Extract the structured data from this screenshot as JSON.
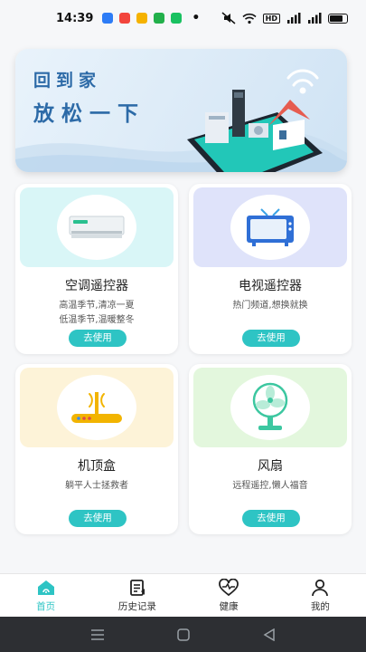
{
  "status_bar": {
    "time": "14:39",
    "indicators": "HD",
    "app_icon_colors": [
      "#2d7cf6",
      "#f2453d",
      "#f5b200",
      "#22b04b",
      "#19c161"
    ]
  },
  "banner": {
    "line1": "回到家",
    "line2": "放松一下"
  },
  "cards": [
    {
      "title": "空调遥控器",
      "desc1": "高温季节,清凉一夏",
      "desc2": "低温季节,温暖整冬",
      "button": "去使用",
      "icon": "air-conditioner-icon",
      "bg": "#d9f6f7"
    },
    {
      "title": "电视遥控器",
      "desc1": "热门频道,想换就换",
      "button": "去使用",
      "icon": "television-icon",
      "bg": "#dfe3fa"
    },
    {
      "title": "机顶盒",
      "desc1": "躺平人士拯救者",
      "button": "去使用",
      "icon": "set-top-box-icon",
      "bg": "#fdf3d8"
    },
    {
      "title": "风扇",
      "desc1": "远程遥控,懒人福音",
      "button": "去使用",
      "icon": "fan-icon",
      "bg": "#e3f7dd"
    }
  ],
  "tabs": [
    {
      "label": "首页",
      "icon": "home-icon",
      "active": true
    },
    {
      "label": "历史记录",
      "icon": "history-icon",
      "active": false
    },
    {
      "label": "健康",
      "icon": "heart-pulse-icon",
      "active": false
    },
    {
      "label": "我的",
      "icon": "person-icon",
      "active": false
    }
  ],
  "accent_color": "#2ec4c4"
}
